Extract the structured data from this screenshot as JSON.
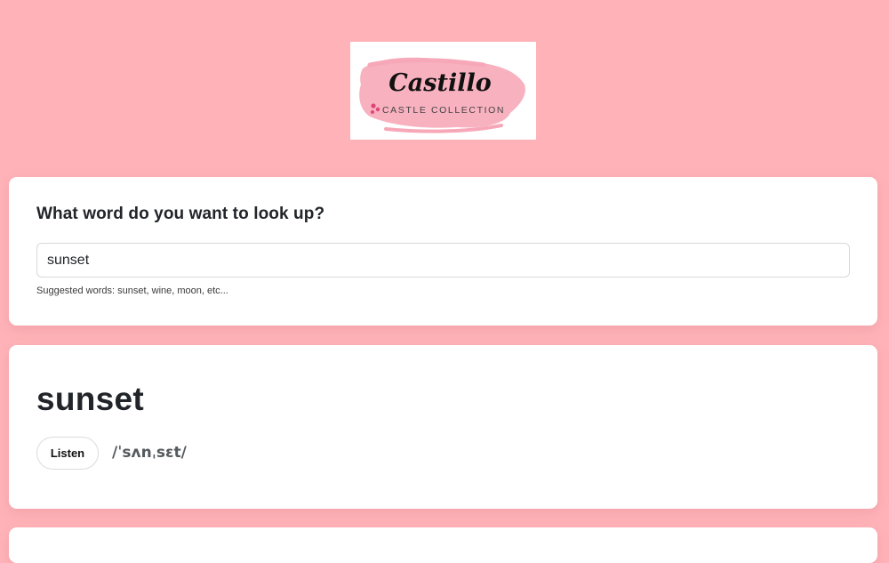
{
  "logo": {
    "brand": "Castillo",
    "tagline": "CASTLE COLLECTION"
  },
  "search": {
    "heading": "What word do you want to look up?",
    "value": "sunset",
    "hint": "Suggested words: sunset, wine, moon, etc..."
  },
  "result": {
    "word": "sunset",
    "listen_label": "Listen",
    "phonetic": "/ˈsʌnˌsɛt/"
  },
  "colors": {
    "background": "#ffb3b8",
    "card": "#ffffff",
    "logo_brush": "#f7a8b8",
    "logo_accent": "#e0457a"
  }
}
